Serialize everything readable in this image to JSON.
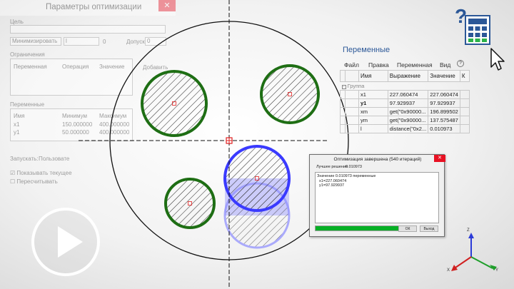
{
  "left_dialog": {
    "title": "Параметры оптимизации",
    "close": "✕",
    "goal_label": "Цель",
    "goal_mode": "Минимизировать",
    "goal_var": "l",
    "goal_value": "0",
    "tolerance_label": "Допуск:",
    "tolerance_value": "0",
    "constraints_label": "Ограничения",
    "constraints_headers": [
      "Переменная",
      "Операция",
      "Значение"
    ],
    "add_label": "Добавить",
    "variables_label": "Переменные",
    "variables_headers": [
      "Имя",
      "Минимум",
      "Максимум"
    ],
    "variables_rows": [
      {
        "name": "x1",
        "min": "150.000000",
        "max": "400.000000"
      },
      {
        "name": "y1",
        "min": "50.000000",
        "max": "400.000000"
      }
    ],
    "run_label": "Запускать:",
    "run_value": "Пользовате",
    "check1_label": "Показывать текущее",
    "check2_label": "Пересчитывать"
  },
  "vars_panel": {
    "title": "Переменные",
    "menu": [
      "Файл",
      "Правка",
      "Переменная",
      "Вид",
      "?"
    ],
    "headers": [
      "Имя",
      "Выражение",
      "Значение",
      "К"
    ],
    "group_label": "Группа",
    "rows": [
      {
        "name": "x1",
        "expr": "227.060474",
        "value": "227.060474",
        "bold": false
      },
      {
        "name": "y1",
        "expr": "97.929937",
        "value": "97.929937",
        "bold": true
      },
      {
        "name": "xm",
        "expr": "get(\"0x90000...",
        "value": "196.899502",
        "bold": false
      },
      {
        "name": "ym",
        "expr": "get(\"0x90000...",
        "value": "137.575487",
        "bold": false
      },
      {
        "name": "l",
        "expr": "distance(\"0x2...",
        "value": "0.010973",
        "bold": false
      }
    ]
  },
  "done_dialog": {
    "title": "Оптимизация завершена (540 итераций)",
    "close": "✕",
    "best_label": "Лучшее решение",
    "best_value": "0.010973",
    "log_lines": [
      "Значение 0.010973 переменные",
      "  x1=227.060474",
      "  y1=97.929937"
    ],
    "progress": 1.0,
    "ok_label": "ОК",
    "exit_label": "Выход"
  },
  "axes": {
    "x": "X",
    "y": "Y",
    "z": "Z"
  },
  "colors": {
    "green": "#1e6e14",
    "blue": "#3a3aff",
    "marker": "#e02020",
    "progress": "#06b025",
    "calc_blue": "#2b5797"
  },
  "icons": [
    "play-icon",
    "calculator-help-icon",
    "cursor-arrow-icon",
    "axis-triad-icon"
  ]
}
